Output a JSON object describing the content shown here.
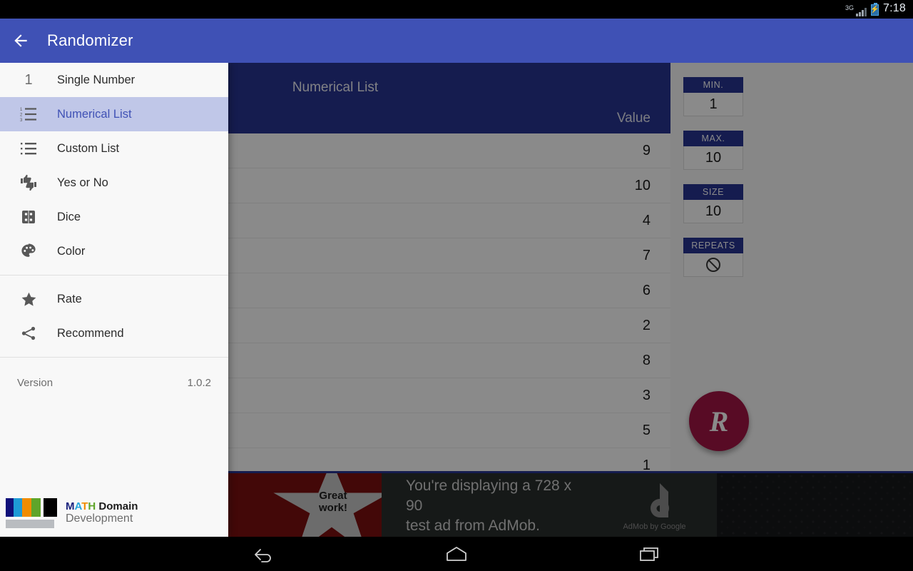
{
  "status_bar": {
    "network": "3G",
    "time": "7:18",
    "battery_icon": "battery-charging-icon",
    "signal_icon": "signal-bars-icon"
  },
  "app_bar": {
    "title": "Randomizer",
    "back_icon": "back-arrow-icon",
    "background": "#3f51b5"
  },
  "drawer": {
    "items": [
      {
        "label": "Single Number",
        "icon": "numeral-one-icon",
        "selected": false
      },
      {
        "label": "Numerical List",
        "icon": "numbered-list-icon",
        "selected": true
      },
      {
        "label": "Custom List",
        "icon": "bulleted-list-icon",
        "selected": false
      },
      {
        "label": "Yes or No",
        "icon": "thumbs-up-down-icon",
        "selected": false
      },
      {
        "label": "Dice",
        "icon": "dice-icon",
        "selected": false
      },
      {
        "label": "Color",
        "icon": "palette-icon",
        "selected": false
      }
    ],
    "secondary_items": [
      {
        "label": "Rate",
        "icon": "star-icon"
      },
      {
        "label": "Recommend",
        "icon": "share-icon"
      }
    ],
    "version_label": "Version",
    "version_value": "1.0.2",
    "brand": {
      "line1_m": "M",
      "line1_a": "A",
      "line1_t": "T",
      "line1_h": "H",
      "line1_rest": " Domain",
      "line2": "Development",
      "logo_colors": [
        "#10107a",
        "#1e9ad6",
        "#f08c00",
        "#5fa52a",
        "#000000"
      ]
    },
    "selected_color": "#c0c7e8",
    "selected_text_color": "#3f51b5"
  },
  "content": {
    "list_title": "Numerical List",
    "column_header": "Value",
    "header_color": "#283593",
    "values": [
      "9",
      "10",
      "4",
      "7",
      "6",
      "2",
      "8",
      "3",
      "5",
      "1"
    ],
    "options": [
      {
        "label": "MIN.",
        "value": "1",
        "type": "text"
      },
      {
        "label": "MAX.",
        "value": "10",
        "type": "text"
      },
      {
        "label": "SIZE",
        "value": "10",
        "type": "text"
      },
      {
        "label": "REPEATS",
        "value": "",
        "type": "no-symbol",
        "icon": "prohibited-icon"
      }
    ],
    "fab_label": "R",
    "fab_color": "#a31545"
  },
  "ad": {
    "star_text_line1": "Great",
    "star_text_line2": "work!",
    "copy_line1": "You're displaying a 728 x 90",
    "copy_line2": "test ad from AdMob.",
    "brand_caption": "AdMob by Google",
    "brand_icon": "admob-logo-icon"
  },
  "nav_bar": {
    "back_icon": "nav-back-icon",
    "home_icon": "nav-home-icon",
    "recents_icon": "nav-recents-icon"
  }
}
